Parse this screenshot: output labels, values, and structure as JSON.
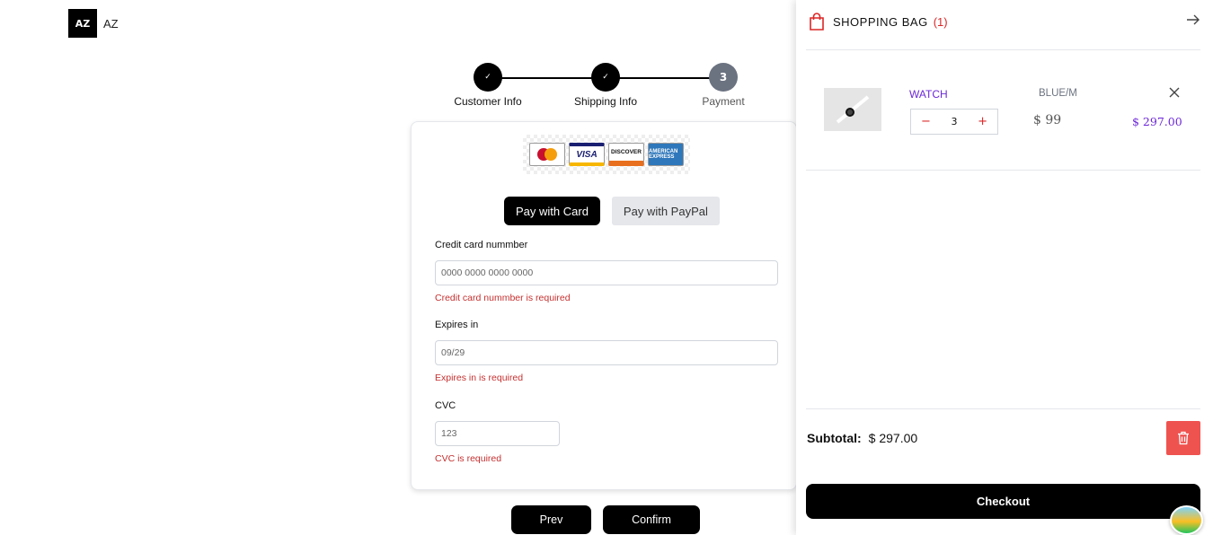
{
  "logo": {
    "mark": "AZ",
    "text": "AZ"
  },
  "stepper": {
    "steps": [
      {
        "label": "Customer Info",
        "state": "done",
        "marker": "✓"
      },
      {
        "label": "Shipping Info",
        "state": "done",
        "marker": "✓"
      },
      {
        "label": "Payment",
        "state": "current",
        "marker": "3"
      }
    ]
  },
  "payment": {
    "card_logos": [
      "MasterCard",
      "VISA",
      "DISCOVER",
      "AMERICAN EXPRESS"
    ],
    "tabs": {
      "card": "Pay with Card",
      "paypal": "Pay with PayPal",
      "active": "card"
    },
    "fields": {
      "card_number": {
        "label": "Credit card nummber",
        "placeholder": "0000 0000 0000 0000",
        "error": "Credit card nummber is required"
      },
      "expires": {
        "label": "Expires in",
        "placeholder": "09/29",
        "error": "Expires in is required"
      },
      "cvc": {
        "label": "CVC",
        "placeholder": "123",
        "error": "CVC is required"
      }
    },
    "buttons": {
      "prev": "Prev",
      "confirm": "Confirm"
    }
  },
  "bag": {
    "title": "SHOPPING BAG",
    "count": "(1)",
    "items": [
      {
        "name": "WATCH",
        "variant": "BLUE/M",
        "quantity": "3",
        "minus": "−",
        "plus": "+",
        "price": "$ 99",
        "total": "$ 297.00"
      }
    ],
    "subtotal_label": "Subtotal:",
    "subtotal_value": "$ 297.00",
    "checkout_label": "Checkout"
  },
  "colors": {
    "accent_purple": "#6d28d9",
    "error_red": "#c53030",
    "trash_red": "#ef5350",
    "primary": "#000000"
  },
  "icons": {
    "bag": "shopping-bag-icon",
    "close_panel": "arrow-right-icon",
    "remove": "close-icon",
    "trash": "trash-icon"
  }
}
